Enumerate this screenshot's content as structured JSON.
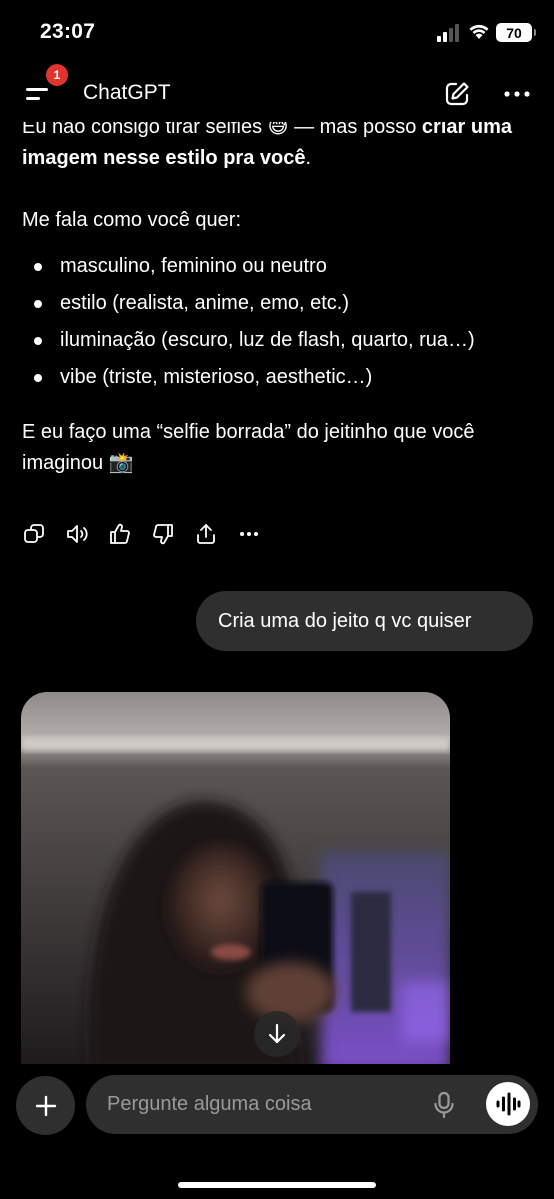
{
  "status_bar": {
    "time": "23:07",
    "battery": "70"
  },
  "header": {
    "title": "ChatGPT",
    "notification_count": "1",
    "icons": [
      "menu-icon",
      "edit-icon",
      "more-icon"
    ]
  },
  "assistant_message": {
    "line1_a": "Eu não consigo tirar selfies 😅 — mas posso ",
    "line1_bold": "criar uma imagem nesse estilo pra você",
    "line1_end": ".",
    "intro": "Me fala como você quer:",
    "bullets": [
      "masculino, feminino ou neutro",
      "estilo (realista, anime, emo, etc.)",
      "iluminação (escuro, luz de flash, quarto, rua…)",
      "vibe (triste, misterioso, aesthetic…)"
    ],
    "closing": "E eu faço uma “selfie borrada” do jeitinho que você imaginou 📸",
    "action_icons": [
      "copy-icon",
      "speaker-icon",
      "thumbs-up-icon",
      "thumbs-down-icon",
      "share-icon",
      "more-icon"
    ]
  },
  "user_message": {
    "text": "Cria uma do jeito q vc quiser"
  },
  "composer": {
    "placeholder": "Pergunte alguma coisa"
  },
  "colors": {
    "background": "#000000",
    "bubble": "#2f2f2f",
    "badge": "#e0342f",
    "placeholder": "#9a9a9a"
  }
}
